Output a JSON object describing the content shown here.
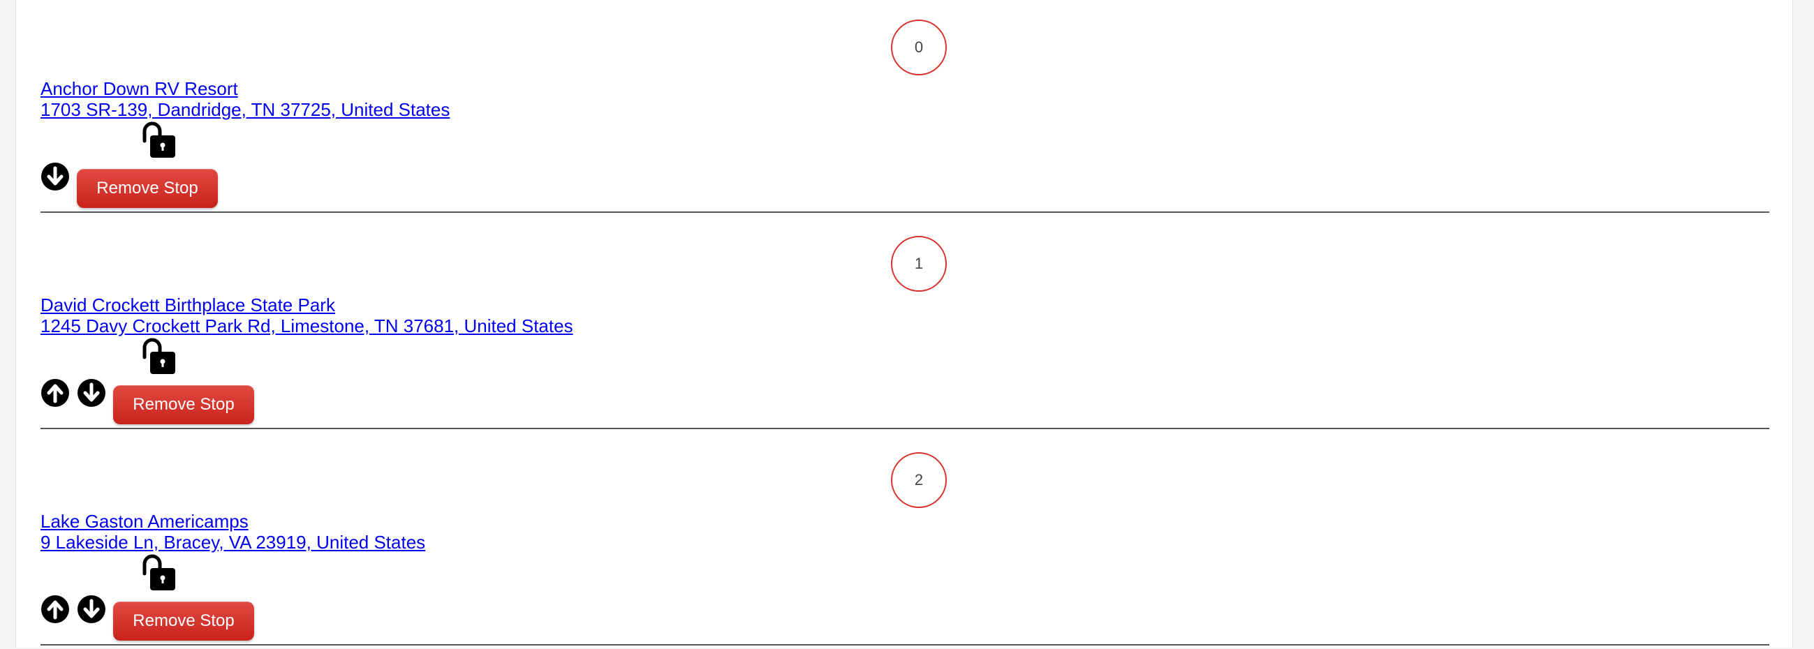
{
  "stops": [
    {
      "number": "0",
      "name": "Anchor Down RV Resort",
      "address": "1703 SR-139, Dandridge, TN 37725, United States",
      "show_up": false,
      "show_down": true,
      "remove_label": "Remove Stop",
      "lock_icon": "unlocked-padlock-icon"
    },
    {
      "number": "1",
      "name": "David Crockett Birthplace State Park",
      "address": "1245 Davy Crockett Park Rd, Limestone, TN 37681, United States",
      "show_up": true,
      "show_down": true,
      "remove_label": "Remove Stop",
      "lock_icon": "unlocked-padlock-icon"
    },
    {
      "number": "2",
      "name": "Lake Gaston Americamps",
      "address": "9 Lakeside Ln, Bracey, VA 23919, United States",
      "show_up": true,
      "show_down": true,
      "remove_label": "Remove Stop",
      "lock_icon": "unlocked-padlock-icon"
    }
  ],
  "colors": {
    "link": "#0000ee",
    "circle_border": "#d9302b",
    "button": "#d12d26",
    "icon": "#000000"
  }
}
